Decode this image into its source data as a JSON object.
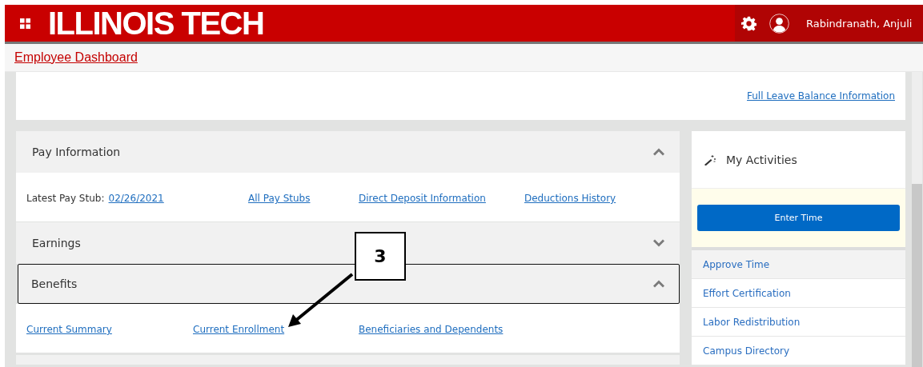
{
  "header": {
    "logo": "ILLINOIS TECH",
    "user": "Rabindranath, Anjuli"
  },
  "breadcrumb": {
    "link": "Employee Dashboard"
  },
  "leave_card": {
    "link": "Full Leave Balance Information"
  },
  "sections": [
    {
      "title": "Pay Information",
      "expanded": true,
      "focused": false,
      "items": [
        {
          "kind": "label-link",
          "label": "Latest Pay Stub:",
          "link": "02/26/2021"
        },
        {
          "kind": "link",
          "link": "All Pay Stubs"
        },
        {
          "kind": "link",
          "link": "Direct Deposit Information"
        },
        {
          "kind": "link",
          "link": "Deductions History"
        }
      ]
    },
    {
      "title": "Earnings",
      "expanded": false,
      "focused": false
    },
    {
      "title": "Benefits",
      "expanded": true,
      "focused": true,
      "items": [
        {
          "kind": "link",
          "link": "Current Summary"
        },
        {
          "kind": "link",
          "link": "Current Enrollment"
        },
        {
          "kind": "link",
          "link": "Beneficiaries and Dependents"
        }
      ]
    }
  ],
  "activities": {
    "title": "My Activities",
    "button": "Enter Time",
    "items": [
      {
        "label": "Approve Time",
        "selected": true
      },
      {
        "label": "Effort Certification",
        "selected": false
      },
      {
        "label": "Labor Redistribution",
        "selected": false
      },
      {
        "label": "Campus Directory",
        "selected": false
      }
    ]
  },
  "annotation": {
    "label": "3"
  }
}
